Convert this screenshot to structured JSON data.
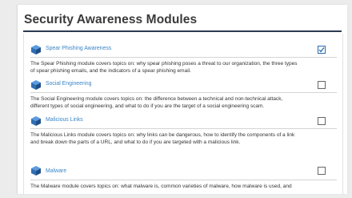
{
  "page": {
    "title": "Security Awareness Modules"
  },
  "modules": [
    {
      "name": "Spear Phishing Awareness",
      "checked": true,
      "desc_lines": [
        "The Spear Phishing module covers topics on: why spear phishing poses a threat to our organization, the three types",
        "of spear phishing emails, and the indicators of a spear phishing email."
      ]
    },
    {
      "name": "Social Engineering",
      "checked": false,
      "desc_lines": [
        "The Social Engineering module covers topics on: the difference between a technical and non-technical attack,",
        "different types of social engineering, and what to do if you are the target of a social engineering scam."
      ]
    },
    {
      "name": "Malicious Links",
      "checked": false,
      "desc_lines": [
        "The Malicious Links module covers topics on: why links can be dangerous, how to identify the components of a link",
        "and break down the parts of a URL, and what to do if you are targeted with a malicious link."
      ]
    },
    {
      "name": "Malware",
      "checked": false,
      "desc_lines": [
        "The Malware module covers topics on: what malware is, common varieties of malware, how malware is used, and"
      ]
    }
  ],
  "colors": {
    "link": "#3b86c6",
    "title_rule": "#2b3a52",
    "icon": "#2f6fb3",
    "check": "#2b6cb0"
  },
  "icon": "cube-icon"
}
